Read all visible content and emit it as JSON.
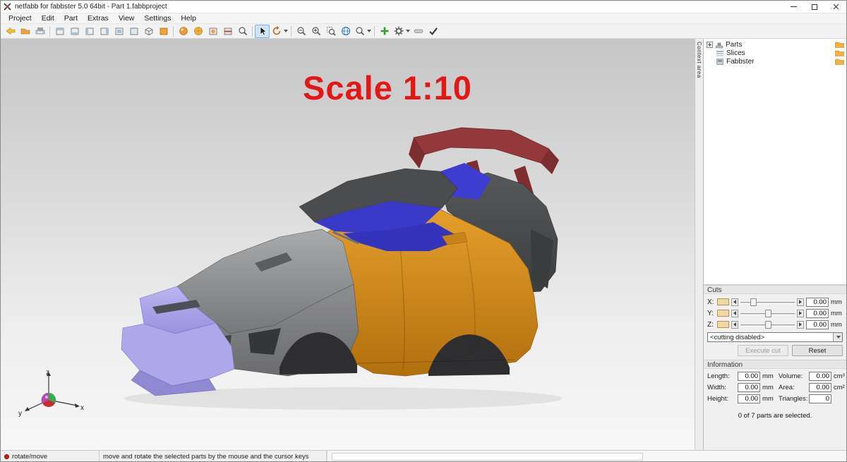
{
  "window": {
    "title": "netfabb for fabbster 5.0 64bit - Part 1.fabbproject"
  },
  "menu": {
    "items": [
      {
        "label": "Project"
      },
      {
        "label": "Edit"
      },
      {
        "label": "Part"
      },
      {
        "label": "Extras"
      },
      {
        "label": "View"
      },
      {
        "label": "Settings"
      },
      {
        "label": "Help"
      }
    ]
  },
  "viewport": {
    "scale_label": "Scale 1:10",
    "axes": {
      "x": "x",
      "y": "y",
      "z": "z"
    }
  },
  "context_panel": {
    "tab": "Context area"
  },
  "tree": {
    "items": [
      {
        "label": "Parts"
      },
      {
        "label": "Slices"
      },
      {
        "label": "Fabbster"
      }
    ]
  },
  "cuts": {
    "title": "Cuts",
    "rows": [
      {
        "axis": "X:",
        "value": "0.00",
        "unit": "mm"
      },
      {
        "axis": "Y:",
        "value": "0.00",
        "unit": "mm"
      },
      {
        "axis": "Z:",
        "value": "0.00",
        "unit": "mm"
      }
    ],
    "mode": "<cutting disabled>",
    "execute_label": "Execute cut",
    "reset_label": "Reset"
  },
  "information": {
    "title": "Information",
    "fields": [
      {
        "label": "Length:",
        "value": "0.00",
        "unit": "mm"
      },
      {
        "label": "Volume:",
        "value": "0.00",
        "unit": "cm³"
      },
      {
        "label": "Width:",
        "value": "0.00",
        "unit": "mm"
      },
      {
        "label": "Area:",
        "value": "0.00",
        "unit": "cm²"
      },
      {
        "label": "Height:",
        "value": "0.00",
        "unit": "mm"
      },
      {
        "label": "Triangles:",
        "value": "0",
        "unit": ""
      }
    ],
    "selection_status": "0 of 7 parts are selected."
  },
  "statusbar": {
    "mode": "rotate/move",
    "hint": "move and rotate the selected parts by the mouse and the cursor keys"
  },
  "model_colors": {
    "body_orange": "#d28a1e",
    "hood_gray": "#8f9092",
    "roof_dark_gray": "#4a4c4e",
    "front_lavender": "#aaa3e6",
    "interior_blue": "#3c3cd2",
    "rear_wing_red": "#92393c",
    "scale_text_red": "#e31717"
  }
}
